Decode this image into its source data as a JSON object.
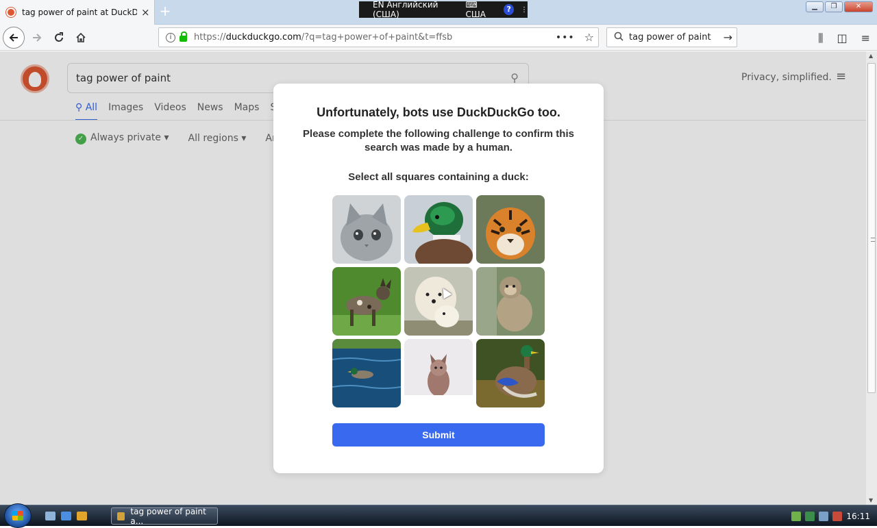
{
  "browser": {
    "tab_title": "tag power of paint at DuckDuckGo",
    "tab_close": "×",
    "new_tab": "+",
    "lang_indicator": "EN Английский (США)",
    "lang_keyboard": "⌨ США",
    "lang_help": "?",
    "url_prefix": "https://",
    "url_domain": "duckduckgo.com",
    "url_path": "/?q=tag+power+of+paint&t=ffsb",
    "url_more": "•••",
    "search_value": "tag power of paint"
  },
  "ddg": {
    "search_value": "tag power of paint",
    "tabs": [
      "All",
      "Images",
      "Videos",
      "News",
      "Maps",
      "Sh"
    ],
    "filters": [
      "Always private ▾",
      "All regions ▾",
      "Any"
    ],
    "tagline": "Privacy, simplified."
  },
  "modal": {
    "title": "Unfortunately, bots use DuckDuckGo too.",
    "subtitle": "Please complete the following challenge to confirm this search was made by a human.",
    "instruction": "Select all squares containing a duck:",
    "submit_label": "Submit",
    "tiles": [
      "cat",
      "duck",
      "tiger",
      "wild dog",
      "polar bears",
      "monkey",
      "duck on water",
      "fox in snow",
      "duck"
    ]
  },
  "taskbar": {
    "task_label": "tag power of paint a...",
    "clock": "16:11"
  },
  "colors": {
    "accent": "#3969ef",
    "ddg_brand": "#de5833",
    "secure_lock": "#12bc00"
  }
}
